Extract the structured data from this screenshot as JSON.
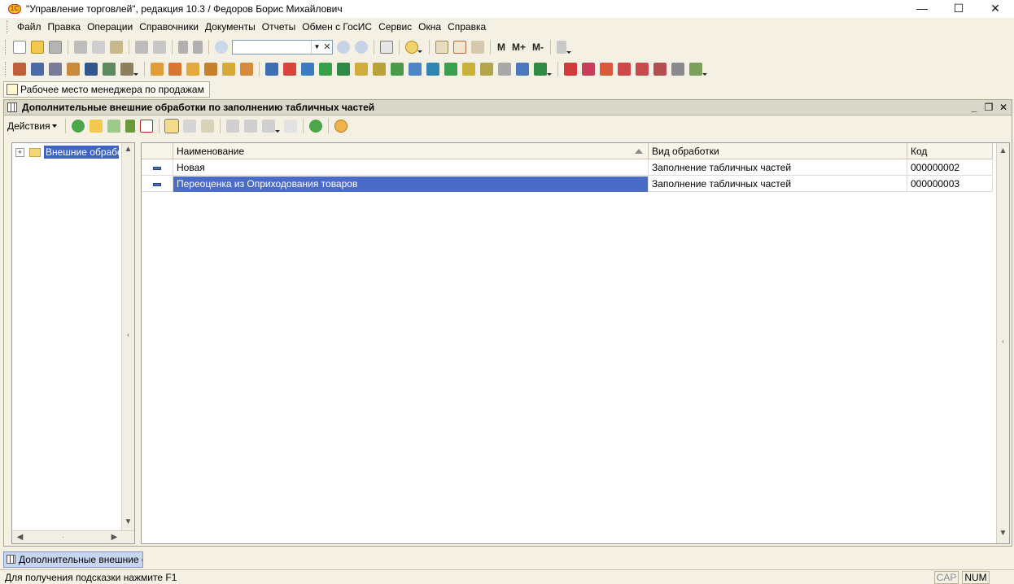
{
  "window": {
    "title": "\"Управление торговлей\", редакция 10.3 / Федоров Борис Михайлович",
    "logo_text": "1С",
    "minimize": "—",
    "maximize": "☐",
    "close": "✕"
  },
  "menu": {
    "items": [
      "Файл",
      "Правка",
      "Операции",
      "Справочники",
      "Документы",
      "Отчеты",
      "Обмен с ГосИС",
      "Сервис",
      "Окна",
      "Справка"
    ]
  },
  "toolbar": {
    "m_label": "M",
    "m_plus_label": "M+",
    "m_minus_label": "M-",
    "search_value": ""
  },
  "panel_tab": {
    "label": "Рабочее место менеджера по продажам"
  },
  "inner_window": {
    "title": "Дополнительные внешние обработки по заполнению табличных частей",
    "actions_label": "Действия",
    "tree_item_label": "Внешние обработки",
    "columns": [
      "Наименование",
      "Вид обработки",
      "Код"
    ],
    "rows": [
      {
        "name": "Новая",
        "type": "Заполнение табличных частей",
        "code": "000000002"
      },
      {
        "name": "Переоценка из Оприходования товаров",
        "type": "Заполнение табличных частей",
        "code": "000000003"
      }
    ]
  },
  "taskbar": {
    "window_tab_label": "Дополнительные внешние о..."
  },
  "status": {
    "hint": "Для получения подсказки нажмите F1",
    "cap": "CAP",
    "num": "NUM"
  },
  "colors": {
    "selection": "#4b6cc6",
    "background": "#f4f1e4",
    "title_bar": "#d9d7c9"
  }
}
